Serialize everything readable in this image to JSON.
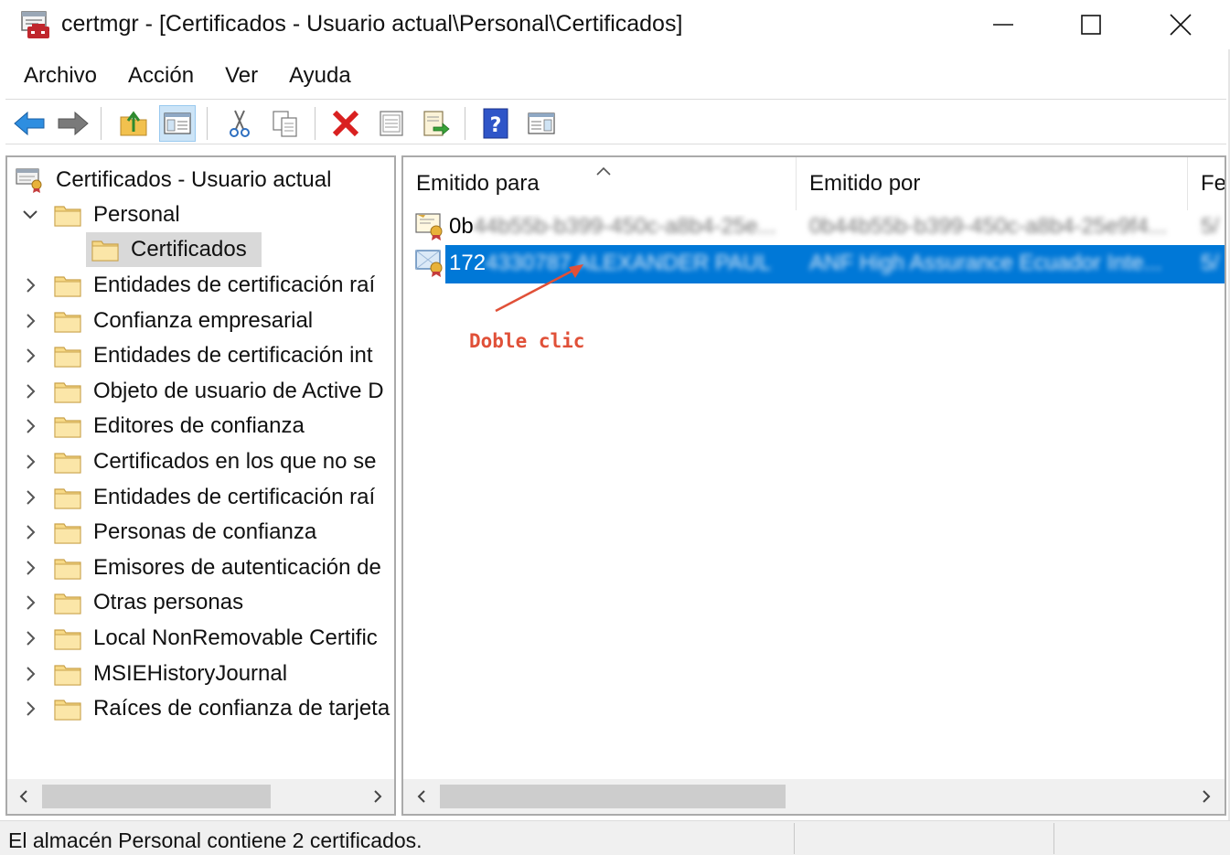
{
  "window": {
    "title": "certmgr - [Certificados - Usuario actual\\Personal\\Certificados]"
  },
  "menu": {
    "items": [
      "Archivo",
      "Acción",
      "Ver",
      "Ayuda"
    ]
  },
  "toolbar": {
    "buttons": [
      "back-icon",
      "forward-icon",
      "up-folder-icon",
      "show-hide-tree-icon",
      "cut-icon",
      "copy-icon",
      "delete-icon",
      "properties-icon",
      "export-list-icon",
      "help-icon",
      "action-pane-icon"
    ]
  },
  "tree": {
    "root": "Certificados - Usuario actual",
    "personal": "Personal",
    "personal_child": "Certificados",
    "items": [
      "Entidades de certificación raí",
      "Confianza empresarial",
      "Entidades de certificación int",
      "Objeto de usuario de Active D",
      "Editores de confianza",
      "Certificados en los que no se",
      "Entidades de certificación raí",
      "Personas de confianza",
      "Emisores de autenticación de",
      "Otras personas",
      "Local NonRemovable Certific",
      "MSIEHistoryJournal",
      "Raíces de confianza de tarjeta"
    ]
  },
  "list": {
    "columns": [
      "Emitido para",
      "Emitido por",
      "Fe"
    ],
    "rows": [
      {
        "issued_to_prefix": "0b",
        "issued_to_rest": "44b55b-b399-450c-a8b4-25e...",
        "issued_by": "0b44b55b-b399-450c-a8b4-25e9f4...",
        "date": "5/",
        "selected": false
      },
      {
        "issued_to_prefix": "172",
        "issued_to_rest": "4330787 ALEXANDER PAUL",
        "issued_by": "ANF High Assurance Ecuador Inte...",
        "date": "5/",
        "selected": true
      }
    ]
  },
  "annotation": {
    "text": "Doble clic",
    "color": "#e05038"
  },
  "status": {
    "text": "El almacén Personal contiene 2 certificados."
  },
  "colors": {
    "selection": "#0078d7",
    "tree_selected_bg": "#d9d9d9"
  }
}
